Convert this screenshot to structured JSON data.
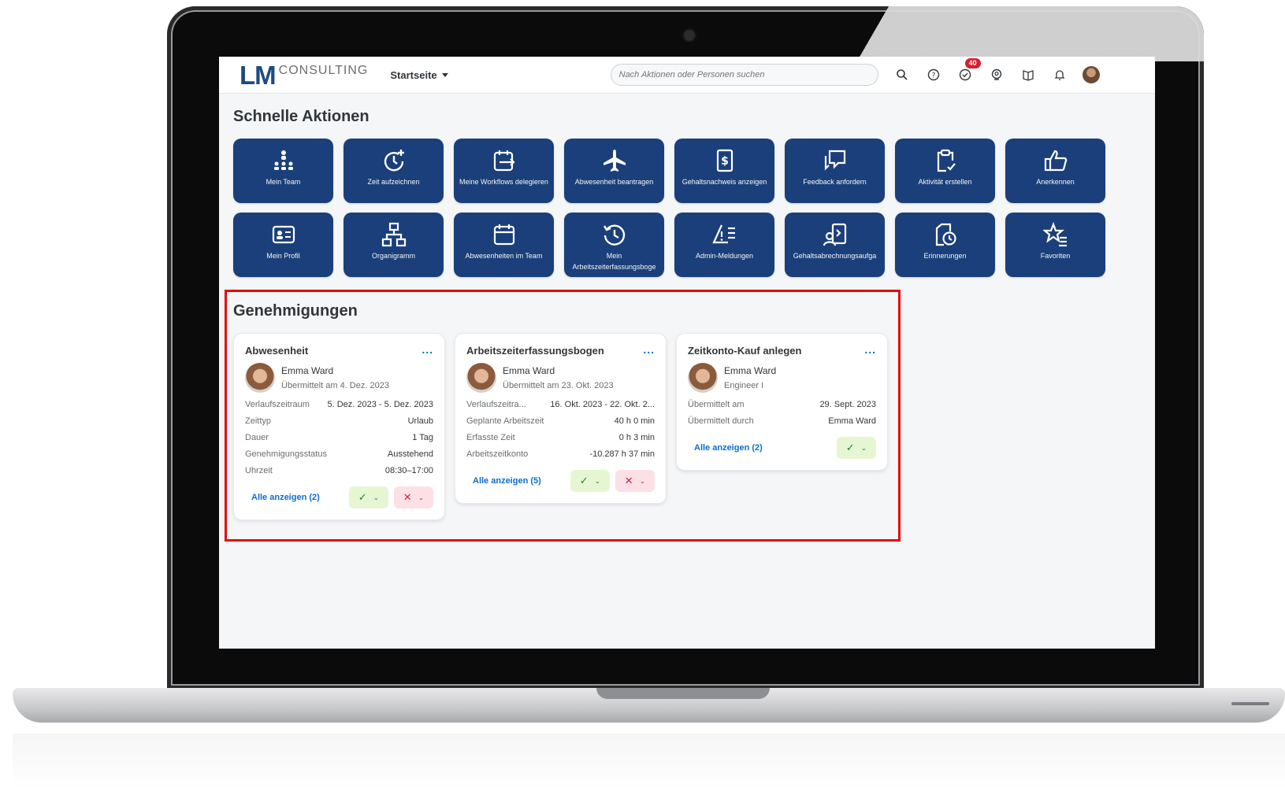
{
  "shell": {
    "logo_main": "LM",
    "logo_sub": "CONSULTING",
    "home_menu": "Startseite",
    "search_placeholder": "Nach Aktionen oder Personen suchen",
    "notification_count": "40"
  },
  "quick_actions": {
    "title": "Schnelle Aktionen",
    "tiles": [
      {
        "label": "Mein Team",
        "icon": "team-icon"
      },
      {
        "label": "Zeit aufzeichnen",
        "icon": "clock-plus-icon"
      },
      {
        "label": "Meine Workflows delegieren",
        "icon": "calendar-delegate-icon"
      },
      {
        "label": "Abwesenheit beantragen",
        "icon": "airplane-icon"
      },
      {
        "label": "Gehaltsnachweis anzeigen",
        "icon": "payslip-icon"
      },
      {
        "label": "Feedback anfordern",
        "icon": "feedback-icon"
      },
      {
        "label": "Aktivität erstellen",
        "icon": "clipboard-check-icon"
      },
      {
        "label": "Anerkennen",
        "icon": "thumbs-up-icon"
      },
      {
        "label": "Mein Profil",
        "icon": "profile-card-icon"
      },
      {
        "label": "Organigramm",
        "icon": "org-chart-icon"
      },
      {
        "label": "Abwesenheiten im Team",
        "icon": "calendar-icon"
      },
      {
        "label": "Mein Arbeitszeiterfassungsboge",
        "icon": "history-icon"
      },
      {
        "label": "Admin-Meldungen",
        "icon": "alert-list-icon"
      },
      {
        "label": "Gehaltsabrechnungsaufga",
        "icon": "payroll-task-icon"
      },
      {
        "label": "Erinnerungen",
        "icon": "reminder-icon"
      },
      {
        "label": "Favoriten",
        "icon": "star-list-icon"
      }
    ]
  },
  "approvals": {
    "title": "Genehmigungen",
    "cards": [
      {
        "title": "Abwesenheit",
        "more": "...",
        "person": "Emma Ward",
        "sub": "Übermittelt am 4. Dez. 2023",
        "rows": [
          {
            "k": "Verlaufszeitraum",
            "v": "5. Dez. 2023 - 5. Dez. 2023"
          },
          {
            "k": "Zeittyp",
            "v": "Urlaub"
          },
          {
            "k": "Dauer",
            "v": "1 Tag"
          },
          {
            "k": "Genehmigungsstatus",
            "v": "Ausstehend"
          },
          {
            "k": "Uhrzeit",
            "v": "08:30–17:00"
          }
        ],
        "show_all": "Alle anzeigen (2)"
      },
      {
        "title": "Arbeitszeiterfassungsbogen",
        "more": "...",
        "person": "Emma Ward",
        "sub": "Übermittelt am 23. Okt. 2023",
        "rows": [
          {
            "k": "Verlaufszeitra...",
            "v": "16. Okt. 2023 - 22. Okt. 2..."
          },
          {
            "k": "Geplante Arbeitszeit",
            "v": "40 h 0 min"
          },
          {
            "k": "Erfasste Zeit",
            "v": "0 h 3 min"
          },
          {
            "k": "Arbeitszeitkonto",
            "v": "-10.287 h 37 min"
          }
        ],
        "show_all": "Alle anzeigen (5)"
      },
      {
        "title": "Zeitkonto-Kauf anlegen",
        "more": "...",
        "person": "Emma Ward",
        "sub": "Engineer I",
        "rows": [
          {
            "k": "Übermittelt am",
            "v": "29. Sept. 2023"
          },
          {
            "k": "Übermittelt durch",
            "v": "Emma Ward"
          }
        ],
        "show_all": "Alle anzeigen (2)"
      }
    ]
  },
  "colors": {
    "tile_bg": "#1b3f7a",
    "accent": "#0a6ed1",
    "approve_bg": "#e6f6d3",
    "reject_bg": "#fde0e6",
    "highlight_frame": "#e10b0b"
  }
}
